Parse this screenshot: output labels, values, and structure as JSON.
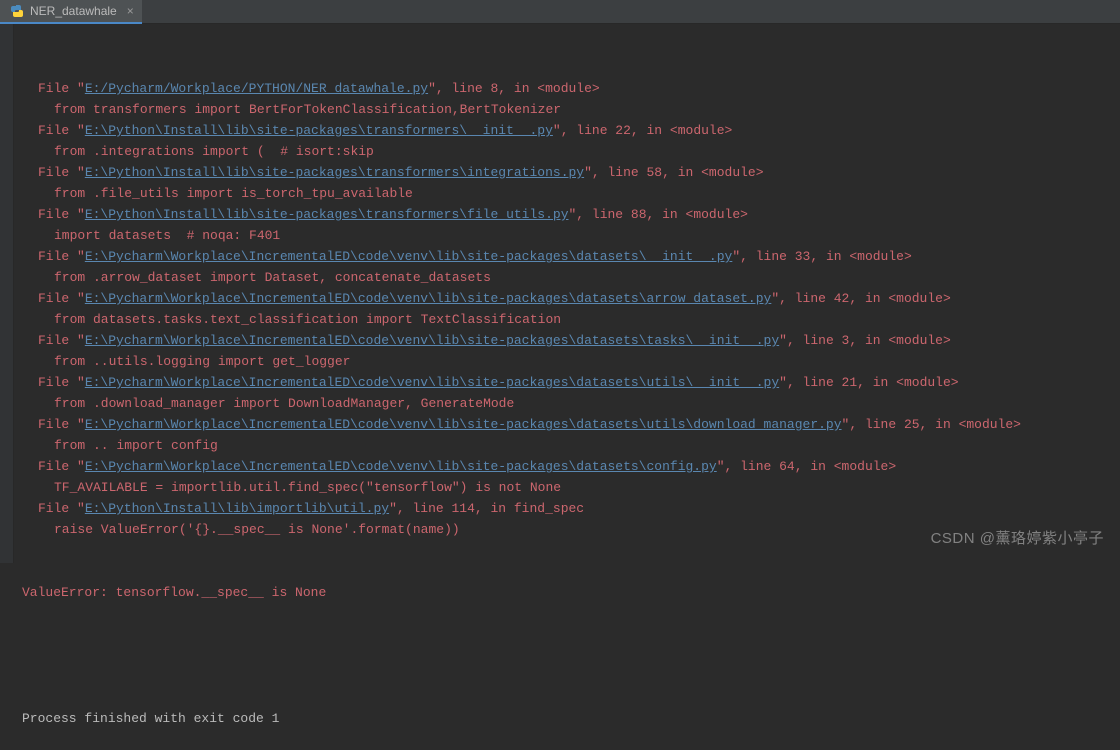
{
  "tab": {
    "label": "NER_datawhale",
    "close_glyph": "×"
  },
  "trace": [
    {
      "path": "E:/Pycharm/Workplace/PYTHON/NER_datawhale.py",
      "line": "8",
      "loc": "<module>",
      "code": "from transformers import BertForTokenClassification,BertTokenizer"
    },
    {
      "path": "E:\\Python\\Install\\lib\\site-packages\\transformers\\__init__.py",
      "line": "22",
      "loc": "<module>",
      "code": "from .integrations import (  # isort:skip"
    },
    {
      "path": "E:\\Python\\Install\\lib\\site-packages\\transformers\\integrations.py",
      "line": "58",
      "loc": "<module>",
      "code": "from .file_utils import is_torch_tpu_available"
    },
    {
      "path": "E:\\Python\\Install\\lib\\site-packages\\transformers\\file_utils.py",
      "line": "88",
      "loc": "<module>",
      "code": "import datasets  # noqa: F401"
    },
    {
      "path": "E:\\Pycharm\\Workplace\\IncrementalED\\code\\venv\\lib\\site-packages\\datasets\\__init__.py",
      "line": "33",
      "loc": "<module>",
      "code": "from .arrow_dataset import Dataset, concatenate_datasets"
    },
    {
      "path": "E:\\Pycharm\\Workplace\\IncrementalED\\code\\venv\\lib\\site-packages\\datasets\\arrow_dataset.py",
      "line": "42",
      "loc": "<module>",
      "code": "from datasets.tasks.text_classification import TextClassification"
    },
    {
      "path": "E:\\Pycharm\\Workplace\\IncrementalED\\code\\venv\\lib\\site-packages\\datasets\\tasks\\__init__.py",
      "line": "3",
      "loc": "<module>",
      "code": "from ..utils.logging import get_logger"
    },
    {
      "path": "E:\\Pycharm\\Workplace\\IncrementalED\\code\\venv\\lib\\site-packages\\datasets\\utils\\__init__.py",
      "line": "21",
      "loc": "<module>",
      "code": "from .download_manager import DownloadManager, GenerateMode"
    },
    {
      "path": "E:\\Pycharm\\Workplace\\IncrementalED\\code\\venv\\lib\\site-packages\\datasets\\utils\\download_manager.py",
      "line": "25",
      "loc": "<module>",
      "code": "from .. import config"
    },
    {
      "path": "E:\\Pycharm\\Workplace\\IncrementalED\\code\\venv\\lib\\site-packages\\datasets\\config.py",
      "line": "64",
      "loc": "<module>",
      "code": "TF_AVAILABLE = importlib.util.find_spec(\"tensorflow\") is not None"
    },
    {
      "path": "E:\\Python\\Install\\lib\\importlib\\util.py",
      "line": "114",
      "loc": "find_spec",
      "code": "raise ValueError('{}.__spec__ is None'.format(name))"
    }
  ],
  "error": "ValueError: tensorflow.__spec__ is None",
  "process_line": "Process finished with exit code 1",
  "strings": {
    "file_prefix": "File \"",
    "line_prefix": "\", line ",
    "in_prefix": ", in "
  },
  "watermark": "CSDN @薰珞婷紫小亭子"
}
